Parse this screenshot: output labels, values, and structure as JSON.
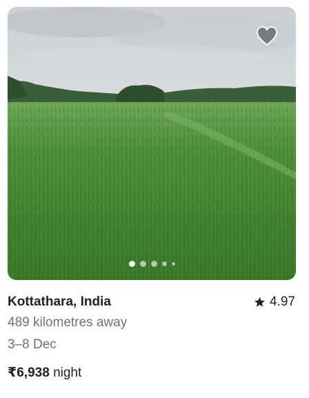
{
  "listing": {
    "location": "Kottathara, India",
    "rating": "4.97",
    "distance": "489 kilometres away",
    "dates": "3–8 Dec",
    "price_amount": "₹6,938",
    "price_unit": "night"
  },
  "photo": {
    "subject": "green paddy field under cloudy sky",
    "carousel_count": 5,
    "carousel_active": 1
  },
  "icons": {
    "wishlist": "heart-icon",
    "rating": "star-icon"
  },
  "colors": {
    "text_primary": "#222222",
    "text_secondary": "#717171",
    "heart_fill": "#6b6b6b"
  }
}
